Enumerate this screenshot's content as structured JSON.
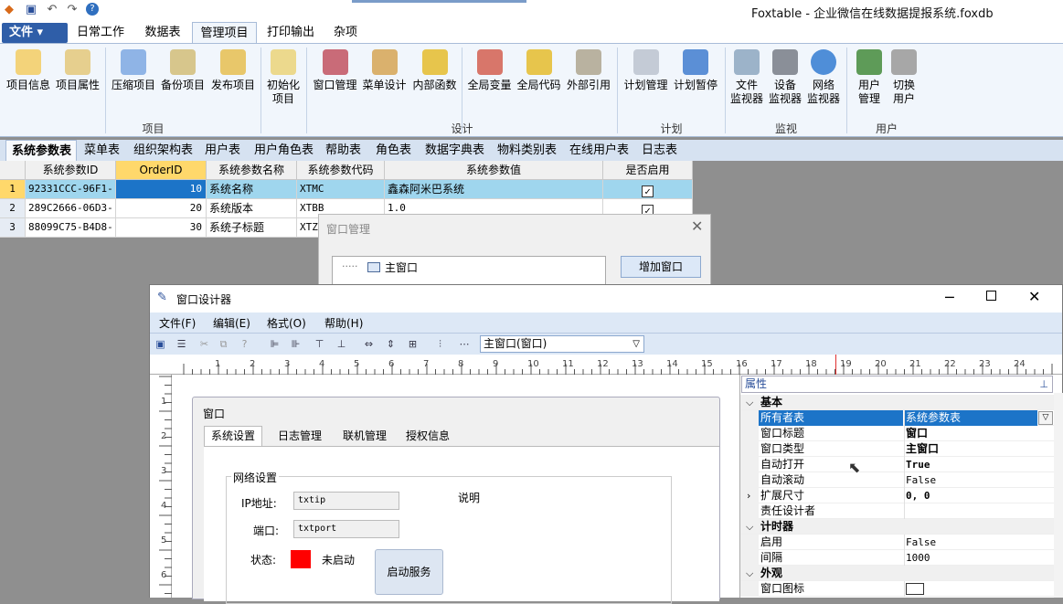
{
  "app": {
    "title": "Foxtable - 企业微信在线数据提报系统.foxdb"
  },
  "menu_tabs": {
    "file": "文件",
    "items": [
      "日常工作",
      "数据表",
      "管理项目",
      "打印输出",
      "杂项"
    ]
  },
  "ribbon": {
    "buttons": [
      "项目信息",
      "项目属性",
      "压缩项目",
      "备份项目",
      "发布项目",
      "初始化\n项目",
      "窗口管理",
      "菜单设计",
      "内部函数",
      "全局变量",
      "全局代码",
      "外部引用",
      "计划管理",
      "计划暂停",
      "文件\n监视器",
      "设备\n监视器",
      "网络\n监视器",
      "用户\n管理",
      "切换\n用户"
    ],
    "groups": [
      "项目",
      "设计",
      "计划",
      "监视",
      "用户"
    ]
  },
  "table_tabs": [
    "系统参数表",
    "菜单表",
    "组织架构表",
    "用户表",
    "用户角色表",
    "帮助表",
    "角色表",
    "数据字典表",
    "物料类别表",
    "在线用户表",
    "日志表"
  ],
  "grid": {
    "columns": [
      "系统参数ID",
      "OrderID",
      "系统参数名称",
      "系统参数代码",
      "系统参数值",
      "是否启用"
    ],
    "rows": [
      {
        "n": "1",
        "id": "92331CCC-96F1-",
        "order": "10",
        "name": "系统名称",
        "code": "XTMC",
        "value": "鑫森阿米巴系统",
        "enabled": "✓"
      },
      {
        "n": "2",
        "id": "289C2666-06D3-",
        "order": "20",
        "name": "系统版本",
        "code": "XTBB",
        "value": "1.0",
        "enabled": "✓"
      },
      {
        "n": "3",
        "id": "88099C75-B4D8-",
        "order": "30",
        "name": "系统子标题",
        "code": "XTZB",
        "value": "",
        "enabled": ""
      }
    ]
  },
  "window_manager": {
    "title": "窗口管理",
    "tree_item": "主窗口",
    "add_button": "增加窗口"
  },
  "designer": {
    "title": "窗口设计器",
    "menu": [
      "文件(F)",
      "编辑(E)",
      "格式(O)",
      "帮助(H)"
    ],
    "object_select": "主窗口(窗口)",
    "ruler_top": [
      "1",
      "2",
      "3",
      "4",
      "5",
      "6",
      "7",
      "8",
      "9",
      "10",
      "11",
      "12",
      "13",
      "14",
      "15",
      "16",
      "17",
      "18",
      "19",
      "20",
      "21",
      "22",
      "23",
      "24"
    ],
    "ruler_left": [
      "1",
      "2",
      "3",
      "4",
      "5",
      "6"
    ],
    "form": {
      "title": "窗口",
      "tabs": [
        "系统设置",
        "日志管理",
        "联机管理",
        "授权信息"
      ],
      "groupbox": "网络设置",
      "ip_label": "IP地址:",
      "ip_value": "txtip",
      "port_label": "端口:",
      "port_value": "txtport",
      "status_label": "状态:",
      "status_text": "未启动",
      "desc_label": "说明",
      "start_button": "启动服务",
      "status_color": "#ff0000"
    },
    "props": {
      "title": "属性",
      "rows": [
        {
          "k": "基本",
          "v": "",
          "cat": true
        },
        {
          "k": "所有者表",
          "v": "系统参数表",
          "sel": true
        },
        {
          "k": "窗口标题",
          "v": "窗口"
        },
        {
          "k": "窗口类型",
          "v": "主窗口"
        },
        {
          "k": "自动打开",
          "v": "True"
        },
        {
          "k": "自动滚动",
          "v": "False"
        },
        {
          "k": "扩展尺寸",
          "v": "0, 0"
        },
        {
          "k": "责任设计者",
          "v": ""
        },
        {
          "k": "计时器",
          "v": "",
          "cat": true
        },
        {
          "k": "启用",
          "v": "False"
        },
        {
          "k": "间隔",
          "v": "1000"
        },
        {
          "k": "外观",
          "v": "",
          "cat": true
        },
        {
          "k": "窗口图标",
          "v": ""
        }
      ]
    }
  },
  "colors": {
    "ribbon_bg": "#f1f6fc",
    "file_button": "#2f5ea8",
    "selection": "#1c74c8",
    "row_select": "#9fd6ee"
  }
}
